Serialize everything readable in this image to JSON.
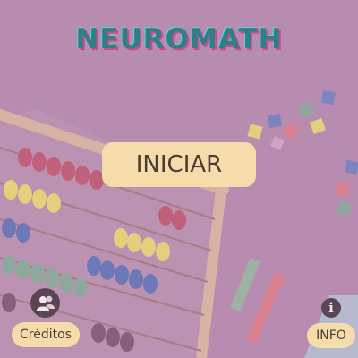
{
  "app": {
    "title": "NEUROMATH"
  },
  "buttons": {
    "start_label": "INICIAR",
    "credits_label": "Créditos",
    "info_label": "INFO",
    "info_glyph": "i"
  },
  "icons": {
    "credits": "users-icon",
    "info": "info-icon"
  },
  "colors": {
    "background": "#b78cb0",
    "button": "#f6dcaa",
    "button_text": "#4b3b32",
    "title": "#2f7f86"
  }
}
